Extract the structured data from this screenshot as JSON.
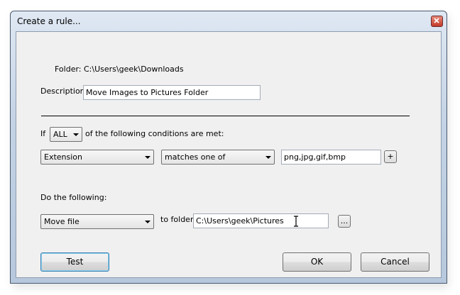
{
  "window": {
    "title": "Create a rule..."
  },
  "folder_label": "Folder: C:\\Users\\geek\\Downloads",
  "description": {
    "label": "Description:",
    "value": "Move Images to Pictures Folder"
  },
  "conditions": {
    "if_label": "If",
    "match_mode": "ALL",
    "suffix_label": "of the following conditions are met:",
    "rows": [
      {
        "field": "Extension",
        "operator": "matches one of",
        "value": "png,jpg,gif,bmp",
        "add_label": "+"
      }
    ]
  },
  "actions": {
    "header": "Do the following:",
    "action": "Move file",
    "target_label": "to folder:",
    "target_value": "C:\\Users\\geek\\Pictures",
    "browse_label": "..."
  },
  "buttons": {
    "test": "Test",
    "ok": "OK",
    "cancel": "Cancel"
  },
  "icons": {
    "close": "close-icon",
    "dropdown": "chevron-down-icon",
    "cursor": "text-cursor-icon"
  },
  "colors": {
    "title_bar": "#c4d3e5",
    "client_bg": "#f0f0f0",
    "close_button": "#c23a28"
  }
}
